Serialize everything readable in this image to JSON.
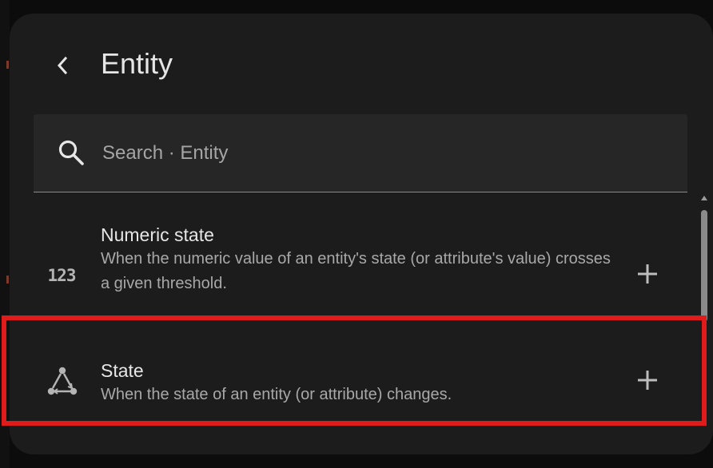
{
  "header": {
    "title": "Entity",
    "back_icon": "chevron-left-icon"
  },
  "search": {
    "placeholder": "Search · Entity",
    "value": "",
    "icon": "search-icon"
  },
  "items": [
    {
      "icon": "numeric-123-icon",
      "icon_text": "123",
      "title": "Numeric state",
      "description": "When the numeric value of an entity's state (or attribute's value) crosses a given threshold.",
      "action_icon": "plus-icon"
    },
    {
      "icon": "state-machine-icon",
      "title": "State",
      "description": "When the state of an entity (or attribute) changes.",
      "action_icon": "plus-icon",
      "highlighted": true
    }
  ],
  "colors": {
    "background": "#0c0c0c",
    "dialog": "#1c1c1c",
    "search_field": "#262626",
    "text_primary": "#e6e6e6",
    "text_secondary": "#a8a8a8",
    "highlight": "#e01b1b"
  }
}
